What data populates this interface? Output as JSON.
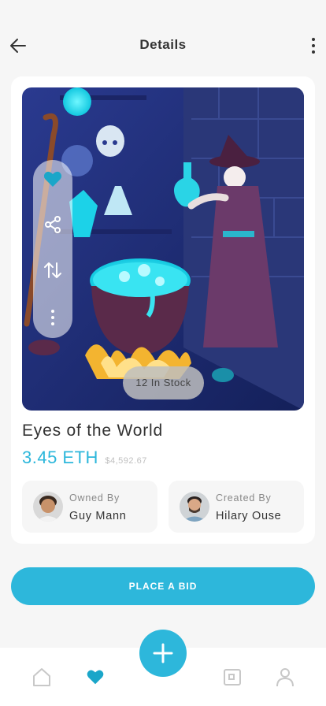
{
  "header": {
    "title": "Details",
    "back_icon": "arrow-left-icon",
    "more_icon": "more-vertical-icon"
  },
  "nft": {
    "stock": "12 In Stock",
    "name": "Eyes of the World",
    "price": "3.45 ETH",
    "fiat_price": "$4,592.67"
  },
  "owner": {
    "role": "Owned By",
    "name": "Guy Mann"
  },
  "creator": {
    "role": "Created By",
    "name": "Hilary Ouse"
  },
  "actions": [
    "heart-icon",
    "share-icon",
    "swap-icon",
    "more-vertical-icon"
  ],
  "bid_button": "PLACE A BID",
  "bottom_nav": [
    "home-icon",
    "heart-icon",
    "add-icon",
    "wallet-icon",
    "profile-icon"
  ],
  "colors": {
    "accent": "#2db7db",
    "art_background": "#1f2d6e",
    "heart_active": "#1aa6c9"
  }
}
